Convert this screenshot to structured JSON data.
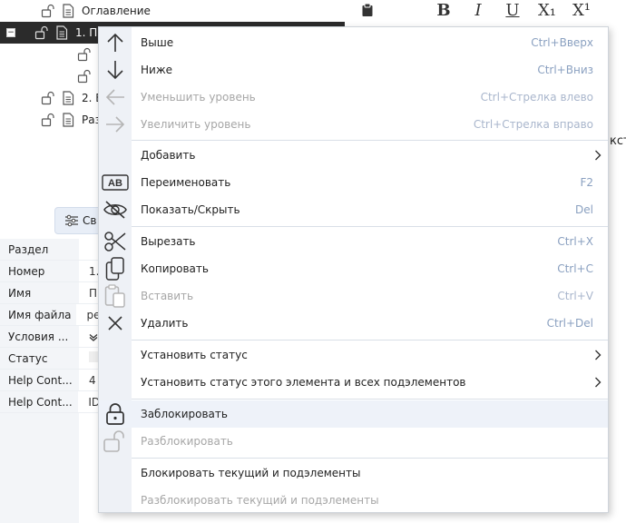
{
  "tree": {
    "items": [
      {
        "label": "Оглавление"
      },
      {
        "label": "1. П"
      },
      {
        "label": ""
      },
      {
        "label": ""
      },
      {
        "label": "2. В"
      },
      {
        "label": "Раз"
      }
    ],
    "expander_symbol": "−"
  },
  "format_toolbar": {
    "bold": "B",
    "italic": "I",
    "underline": "U",
    "subscript": "X₁",
    "superscript": "X¹"
  },
  "side_text": "кст",
  "properties": {
    "button_label": "Св",
    "rows": [
      {
        "key": "Раздел",
        "value": ""
      },
      {
        "key": "Номер",
        "value": "1."
      },
      {
        "key": "Имя",
        "value": "П"
      },
      {
        "key": "Имя файла",
        "value": "ре"
      },
      {
        "key": "Условия ...",
        "value": ""
      },
      {
        "key": "Статус",
        "value": ""
      },
      {
        "key": "Help Cont...",
        "value": "4"
      },
      {
        "key": "Help Cont...",
        "value": "ID"
      }
    ]
  },
  "context_menu": {
    "items": [
      {
        "label": "Выше",
        "shortcut": "Ctrl+Вверх",
        "icon": "arrow-up-icon",
        "disabled": false
      },
      {
        "label": "Ниже",
        "shortcut": "Ctrl+Вниз",
        "icon": "arrow-down-icon",
        "disabled": false
      },
      {
        "label": "Уменьшить уровень",
        "shortcut": "Ctrl+Стрелка влево",
        "icon": "arrow-left-icon",
        "disabled": true
      },
      {
        "label": "Увеличить уровень",
        "shortcut": "Ctrl+Стрелка вправо",
        "icon": "arrow-right-icon",
        "disabled": true
      },
      {
        "label": "Добавить",
        "shortcut": "",
        "icon": "",
        "disabled": false,
        "submenu": true
      },
      {
        "label": "Переименовать",
        "shortcut": "F2",
        "icon": "rename-ab-icon",
        "disabled": false
      },
      {
        "label": "Показать/Скрыть",
        "shortcut": "Del",
        "icon": "eye-off-icon",
        "disabled": false
      },
      {
        "label": "Вырезать",
        "shortcut": "Ctrl+X",
        "icon": "scissors-icon",
        "disabled": false
      },
      {
        "label": "Копировать",
        "shortcut": "Ctrl+C",
        "icon": "copy-icon",
        "disabled": false
      },
      {
        "label": "Вставить",
        "shortcut": "Ctrl+V",
        "icon": "paste-icon",
        "disabled": true
      },
      {
        "label": "Удалить",
        "shortcut": "Ctrl+Del",
        "icon": "close-icon",
        "disabled": false
      },
      {
        "label": "Установить статус",
        "shortcut": "",
        "icon": "",
        "disabled": false,
        "submenu": true
      },
      {
        "label": "Установить статус этого элемента и всех подэлементов",
        "shortcut": "",
        "icon": "",
        "disabled": false,
        "submenu": true
      },
      {
        "label": "Заблокировать",
        "shortcut": "",
        "icon": "lock-icon",
        "disabled": false,
        "highlighted": true
      },
      {
        "label": "Разблокировать",
        "shortcut": "",
        "icon": "unlock-icon",
        "disabled": true
      },
      {
        "label": "Блокировать текущий и подэлементы",
        "shortcut": "",
        "icon": "",
        "disabled": false
      },
      {
        "label": "Разблокировать текущий и подэлементы",
        "shortcut": "",
        "icon": "",
        "disabled": true
      }
    ]
  },
  "colors": {
    "selected_row": "#2b2b2b",
    "menu_gutter": "#eef1f6",
    "shortcut_text": "#8aa0c0",
    "disabled_text": "#a6a6a6",
    "highlight": "#eef2f9"
  }
}
